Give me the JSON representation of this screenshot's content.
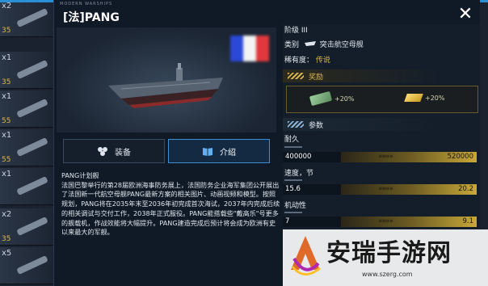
{
  "brand": "MODERN WARSHIPS",
  "dialog": {
    "title": "[法]PANG",
    "flag_colors": [
      "#2b49d6",
      "#f4f4f4",
      "#e0383c"
    ]
  },
  "tabs": {
    "equip": "装备",
    "intro": "介绍"
  },
  "description": {
    "title": "PANG计划舰",
    "body": "法国巴黎举行的第28届欧洲海事防务展上，法国防务企业海军集团公开展出了法国新一代航空母舰PANG最新方案的相关图片、动画视频和模型。按照规划，PANG将在2035年末至2036年初完成首次海试，2037年内完成后续的相关调试与交付工作，2038年正式服役。PANG能搭载些\"戴高乐\"号更多的舰载机，作战效能将大幅提升。PANG建造完成后预计将会成为欧洲有史以来最大的军舰。"
  },
  "info": {
    "tier": "阶级 III",
    "class_label": "类别",
    "class_value": "突击航空母舰",
    "rarity_label": "稀有度：",
    "rarity_value": "传说"
  },
  "rewards": {
    "header": "奖励",
    "cash": "+20%",
    "gold": "+20%"
  },
  "params": {
    "header": "参数",
    "stats": [
      {
        "label": "耐久",
        "base": "400000",
        "max": "520000",
        "fraction": 0.77
      },
      {
        "label": "速度，节",
        "base": "15.6",
        "max": "20.2",
        "fraction": 0.77
      },
      {
        "label": "机动性",
        "base": "7",
        "max": "9.1",
        "fraction": 0.77
      }
    ]
  },
  "inventory": [
    {
      "qty": "x2",
      "level": "35"
    },
    {
      "qty": "x1",
      "level": "35"
    },
    {
      "qty": "x1",
      "level": "55"
    },
    {
      "qty": "x1",
      "level": "55"
    },
    {
      "qty": "x1",
      "level": ""
    },
    {
      "qty": "x2",
      "level": "35"
    },
    {
      "qty": "x5",
      "level": ""
    }
  ],
  "watermark": {
    "text": "安瑞手游网",
    "url": "www.szerg.com"
  }
}
